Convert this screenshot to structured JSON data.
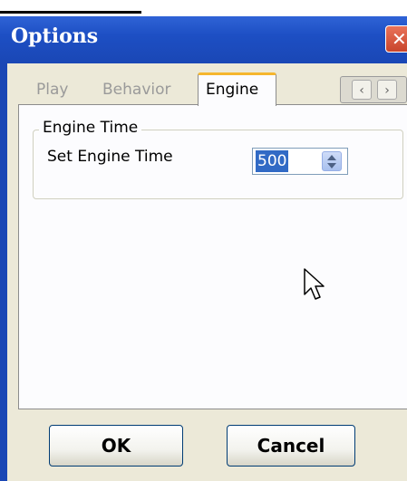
{
  "window": {
    "title": "Options",
    "close_label": "✕"
  },
  "tabs": [
    {
      "label": "Play",
      "selected": false
    },
    {
      "label": "Behavior",
      "selected": false
    },
    {
      "label": "Engine",
      "selected": true
    }
  ],
  "tab_scroll": {
    "left_icon": "chevron-left-icon",
    "right_icon": "chevron-right-icon",
    "left_glyph": "‹",
    "right_glyph": "›"
  },
  "engine_group": {
    "title": "Engine Time",
    "set_label": "Set Engine Time",
    "value": "500"
  },
  "buttons": {
    "ok": "OK",
    "cancel": "Cancel"
  },
  "colors": {
    "titlebar": "#1d4fc4",
    "selected_value_bg": "#316ac5",
    "tab_highlight": "#f5b62e"
  }
}
